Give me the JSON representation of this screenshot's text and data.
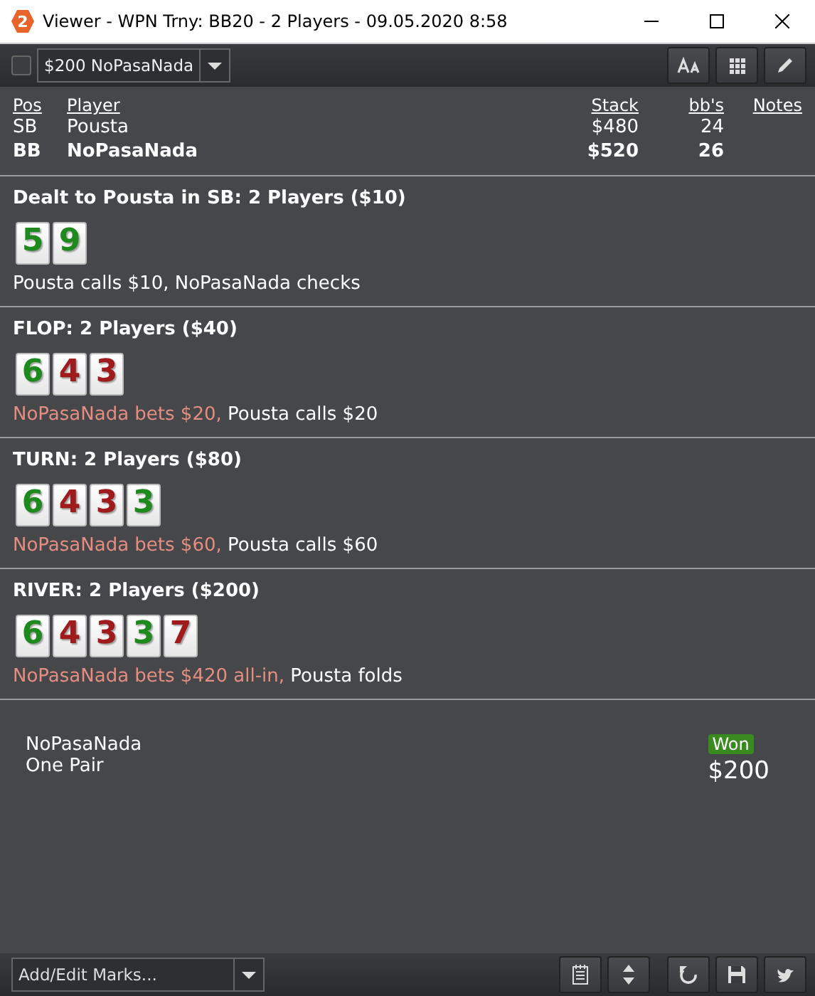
{
  "window": {
    "logo": "2",
    "title": "Viewer - WPN Trny: BB20 - 2 Players - 09.05.2020 8:58"
  },
  "toolbar": {
    "checked": false,
    "hand_select": "$200 NoPasaNada"
  },
  "players": {
    "columns": [
      "Pos",
      "Player",
      "Stack",
      "bb's",
      "Notes"
    ],
    "rows": [
      {
        "pos": "SB",
        "player": "Pousta",
        "stack": "$480",
        "bbs": "24",
        "hero": false
      },
      {
        "pos": "BB",
        "player": "NoPasaNada",
        "stack": "$520",
        "bbs": "26",
        "hero": true
      }
    ]
  },
  "streets": [
    {
      "title": "Dealt to Pousta in SB: 2 Players ($10)",
      "cards": [
        {
          "rank": "5",
          "color": "#1e8a1e"
        },
        {
          "rank": "9",
          "color": "#1e8a1e"
        }
      ],
      "actions": [
        {
          "text": "Pousta calls $10, NoPasaNada checks",
          "kind": "passive"
        }
      ]
    },
    {
      "title": "FLOP: 2 Players ($40)",
      "cards": [
        {
          "rank": "6",
          "color": "#1e8a1e"
        },
        {
          "rank": "4",
          "color": "#a01c1c"
        },
        {
          "rank": "3",
          "color": "#a01c1c"
        }
      ],
      "actions": [
        {
          "text": "NoPasaNada bets $20,",
          "kind": "aggressive"
        },
        {
          "text": "Pousta calls $20",
          "kind": "passive"
        }
      ]
    },
    {
      "title": "TURN: 2 Players ($80)",
      "cards": [
        {
          "rank": "6",
          "color": "#1e8a1e"
        },
        {
          "rank": "4",
          "color": "#a01c1c"
        },
        {
          "rank": "3",
          "color": "#a01c1c"
        },
        {
          "rank": "3",
          "color": "#1e8a1e"
        }
      ],
      "actions": [
        {
          "text": "NoPasaNada bets $60,",
          "kind": "aggressive"
        },
        {
          "text": "Pousta calls $60",
          "kind": "passive"
        }
      ]
    },
    {
      "title": "RIVER: 2 Players ($200)",
      "cards": [
        {
          "rank": "6",
          "color": "#1e8a1e"
        },
        {
          "rank": "4",
          "color": "#a01c1c"
        },
        {
          "rank": "3",
          "color": "#a01c1c"
        },
        {
          "rank": "3",
          "color": "#1e8a1e"
        },
        {
          "rank": "7",
          "color": "#a01c1c"
        }
      ],
      "actions": [
        {
          "text": "NoPasaNada bets $420 all-in,",
          "kind": "aggressive"
        },
        {
          "text": "Pousta folds",
          "kind": "passive"
        }
      ]
    }
  ],
  "result": {
    "player": "NoPasaNada",
    "hand": "One Pair",
    "badge": "Won",
    "amount": "$200"
  },
  "bottom_bar": {
    "marks_placeholder": "Add/Edit Marks..."
  }
}
